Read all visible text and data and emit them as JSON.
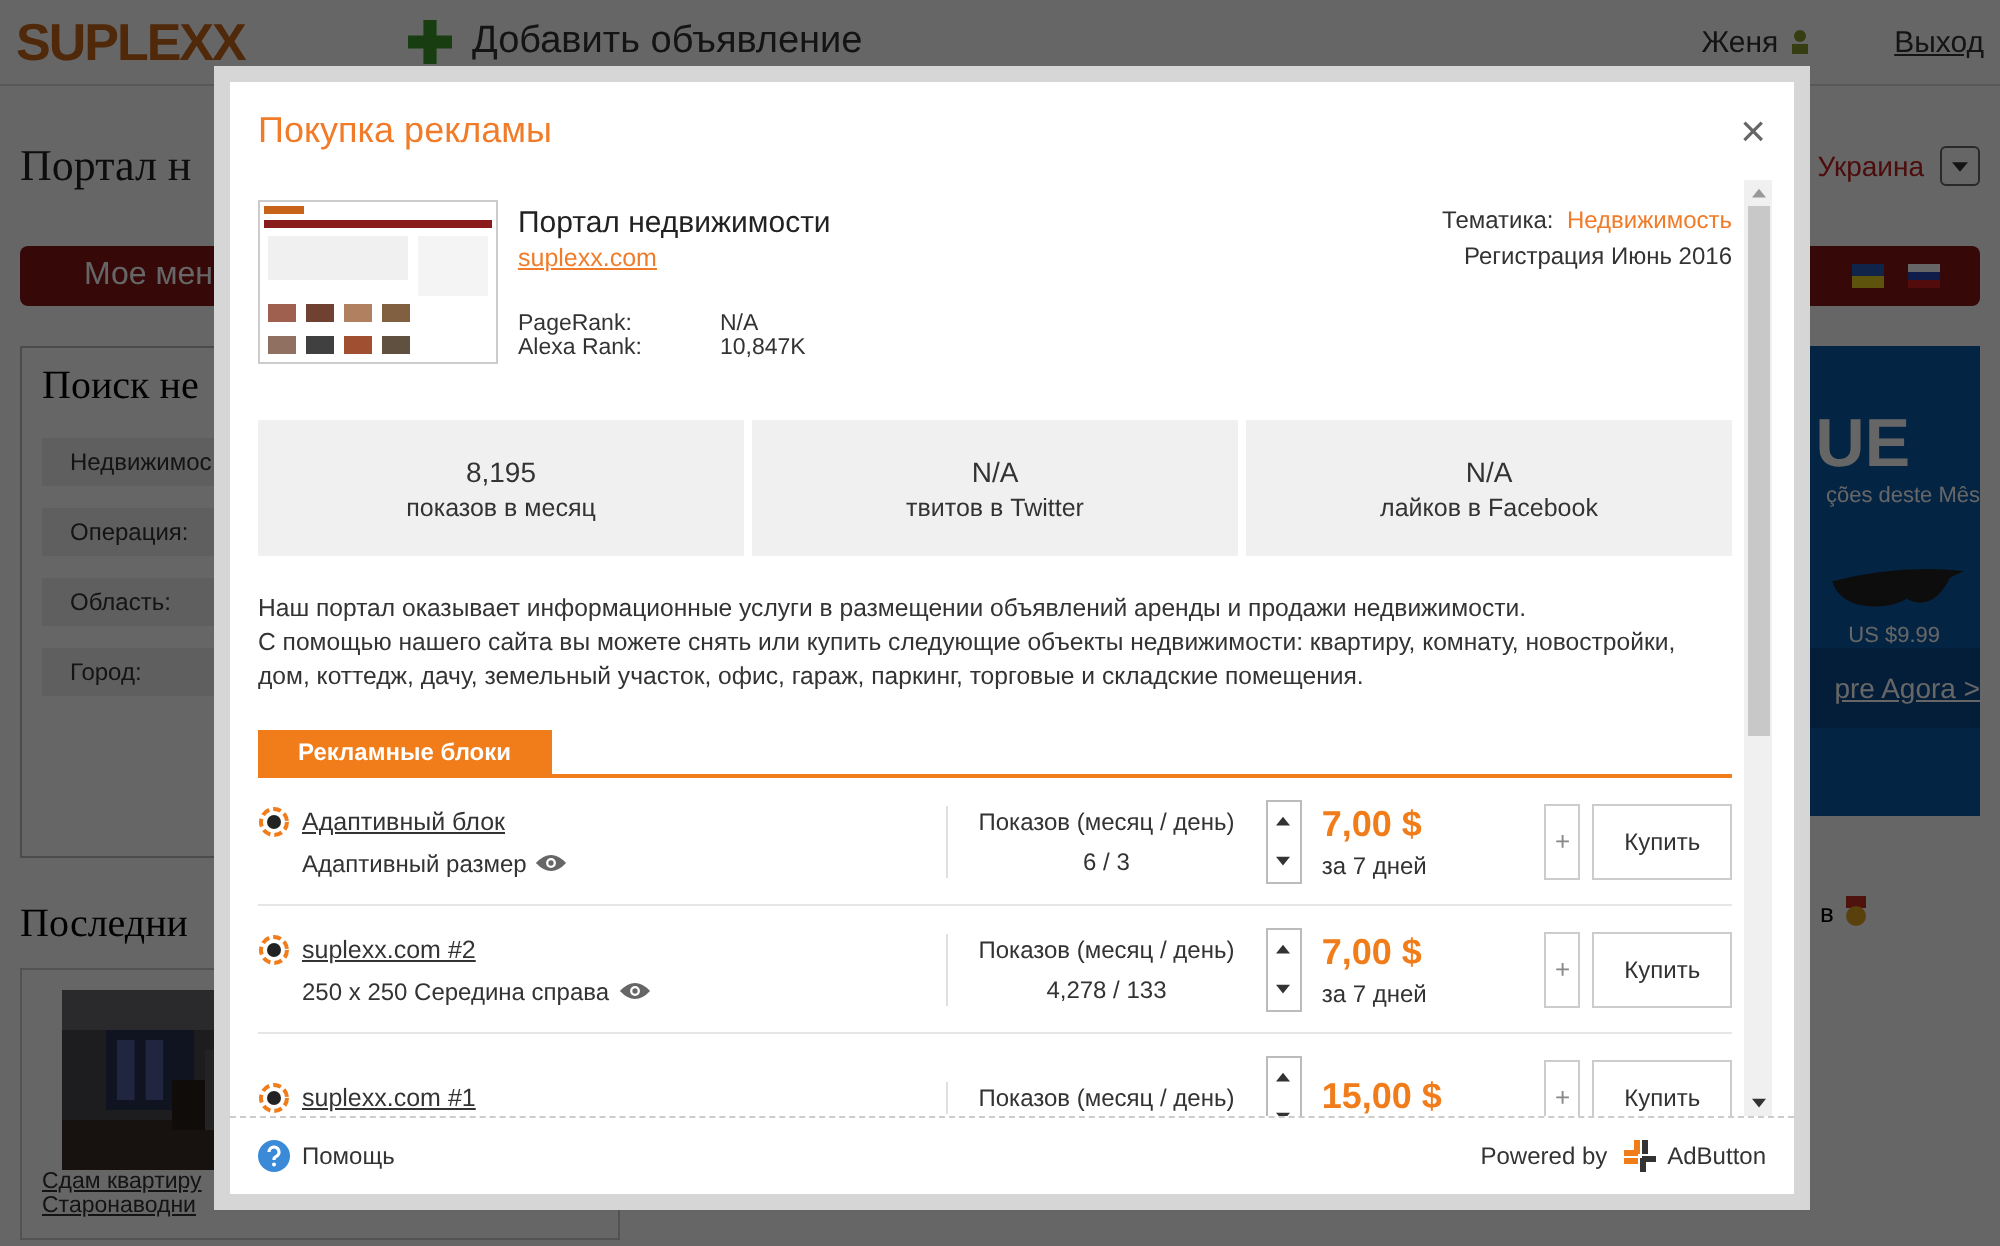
{
  "background": {
    "logo": "SUPLEXX",
    "add_listing": "Добавить объявление",
    "user": "Женя",
    "logout": "Выход",
    "page_title": "Портал н",
    "region": "Украина",
    "menu_button": "Мое мен",
    "search_title": "Поиск не",
    "search_fields": [
      "Недвижимос",
      "Операция:",
      "Область:",
      "Город:"
    ],
    "latest_title": "Последни",
    "listing_links": [
      "Сдам квартиру",
      "Старонаводни"
    ],
    "ad": {
      "headline": "UE",
      "subline": "ções deste Mês",
      "price": "US $9.99",
      "cta": "pre Agora >"
    },
    "side_text": "в"
  },
  "dialog": {
    "title": "Покупка рекламы",
    "close": "×",
    "site": {
      "name": "Портал недвижимости",
      "url": "suplexx.com",
      "topic_label": "Тематика:",
      "topic": "Недвижимость",
      "registration": "Регистрация Июнь 2016",
      "metrics": [
        {
          "label": "PageRank:",
          "value": "N/A"
        },
        {
          "label": "Alexa Rank:",
          "value": "10,847K"
        }
      ]
    },
    "stats": [
      {
        "value": "8,195",
        "label": "показов в месяц"
      },
      {
        "value": "N/A",
        "label": "твитов в Twitter"
      },
      {
        "value": "N/A",
        "label": "лайков в Facebook"
      }
    ],
    "description": [
      "Наш портал оказывает информационные услуги в размещении объявлений аренды и продажи недвижимости.",
      "С помощью нашего сайта вы можете снять или купить следующие объекты недвижимости: квартиру, комнату, новостройки, дом, коттедж, дачу, земельный участок, офис, гараж, паркинг, торговые и складские помещения."
    ],
    "tabs": [
      {
        "label": "Рекламные блоки",
        "selected": true
      }
    ],
    "blocks": [
      {
        "name": "Адаптивный блок",
        "subtitle": "Адаптивный размер",
        "impressions_label": "Показов (месяц / день)",
        "impressions": "6  / 3",
        "price": "7,00 $",
        "period": "за 7 дней",
        "add": "+",
        "buy": "Купить"
      },
      {
        "name": "suplexx.com #2",
        "subtitle": "250 x 250 Середина справа",
        "impressions_label": "Показов (месяц / день)",
        "impressions": "4,278  / 133",
        "price": "7,00 $",
        "period": "за 7 дней",
        "add": "+",
        "buy": "Купить"
      },
      {
        "name": "suplexx.com #1",
        "impressions_label": "Показов (месяц / день)",
        "price": "15,00 $",
        "add": "+",
        "buy": "Купить"
      }
    ],
    "footer": {
      "help": "Помощь",
      "powered_by": "Powered by",
      "brand": "AdButton"
    }
  }
}
